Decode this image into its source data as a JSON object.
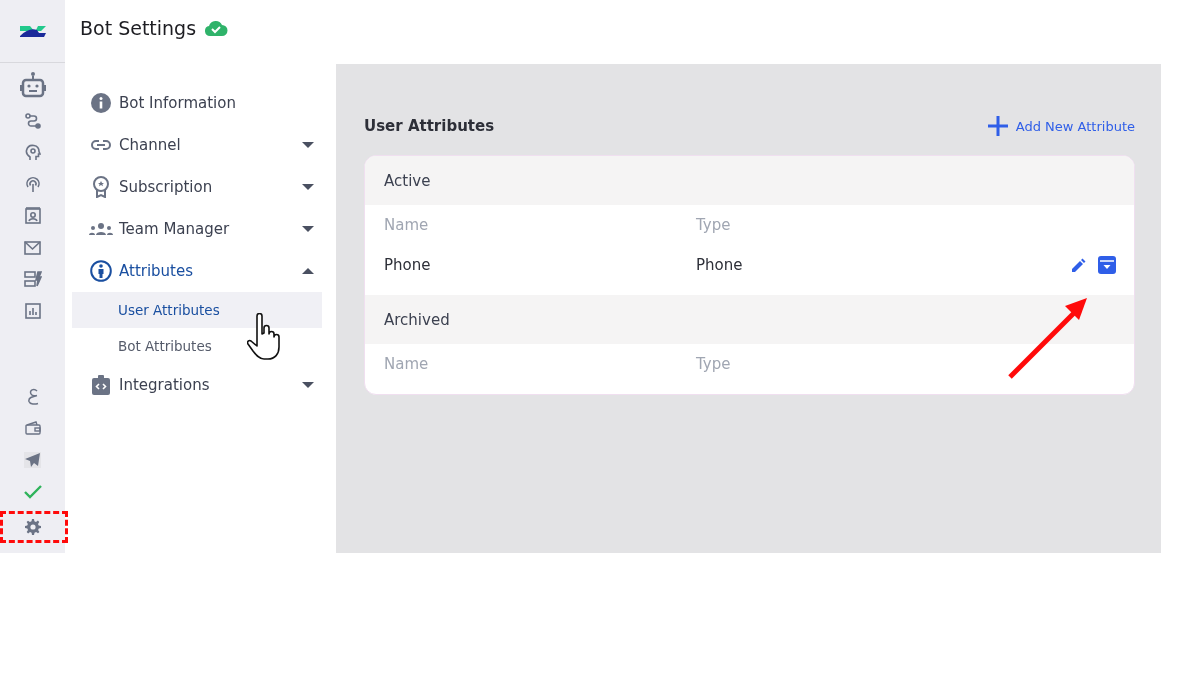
{
  "header": {
    "title": "Bot Settings"
  },
  "sidebar": {
    "items": [
      {
        "kind": "info",
        "label": "Bot Information",
        "selected": false
      },
      {
        "kind": "link",
        "label": "Channel",
        "selected": false,
        "expanded": false
      },
      {
        "kind": "award",
        "label": "Subscription",
        "selected": false,
        "expanded": false
      },
      {
        "kind": "team",
        "label": "Team Manager",
        "selected": false,
        "expanded": false
      },
      {
        "kind": "person",
        "label": "Attributes",
        "selected": true,
        "expanded": true,
        "children": [
          {
            "label": "User Attributes",
            "selected": true
          },
          {
            "label": "Bot Attributes",
            "selected": false
          }
        ]
      },
      {
        "kind": "code",
        "label": "Integrations",
        "selected": false,
        "expanded": false
      }
    ]
  },
  "main": {
    "title": "User Attributes",
    "add_button": "Add New Attribute",
    "sections": [
      {
        "title": "Active",
        "columns": [
          "Name",
          "Type"
        ],
        "rows": [
          {
            "name": "Phone",
            "type": "Phone"
          }
        ]
      },
      {
        "title": "Archived",
        "columns": [
          "Name",
          "Type"
        ]
      }
    ]
  }
}
